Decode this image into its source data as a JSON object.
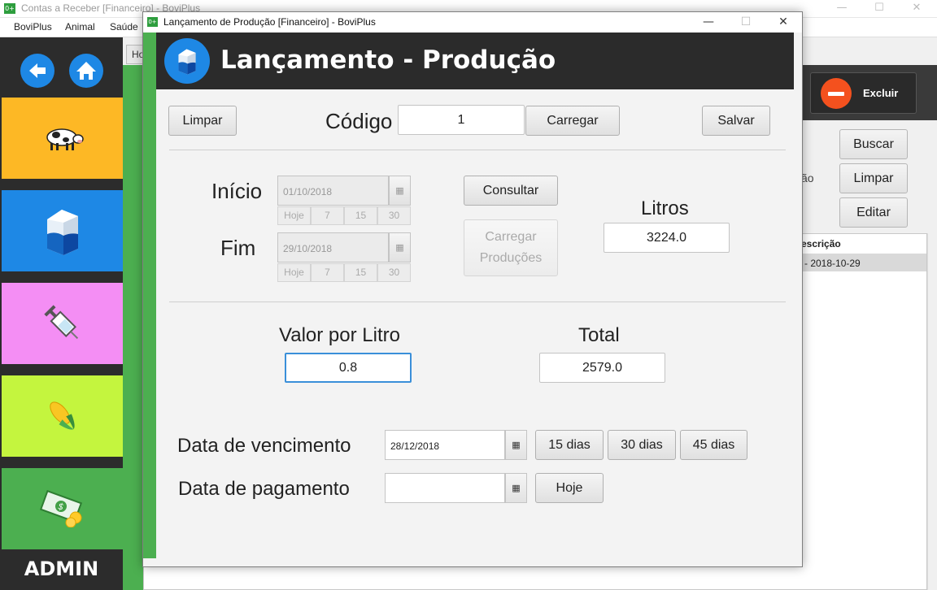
{
  "main_window": {
    "title": "Contas a Receber [Financeiro] - BoviPlus",
    "menu": [
      "BoviPlus",
      "Animal",
      "Saúde"
    ],
    "tab_partial": "Ho",
    "sidebar": {
      "tiles": [
        {
          "name": "animal",
          "icon": "cow-icon",
          "color": "#fdb825"
        },
        {
          "name": "producao",
          "icon": "milk-carton-icon",
          "color": "#1e88e5"
        },
        {
          "name": "saude",
          "icon": "syringe-icon",
          "color": "#f48ef4"
        },
        {
          "name": "alimentacao",
          "icon": "corn-icon",
          "color": "#c4f53e"
        },
        {
          "name": "financeiro",
          "icon": "money-icon",
          "color": "#4caf50"
        }
      ],
      "admin_label": "ADMIN"
    },
    "excluir_label": "Excluir",
    "buttons": {
      "buscar": "Buscar",
      "limpar": "Limpar",
      "editar": "Editar"
    },
    "partial_label": "ão",
    "table": {
      "header_partial": "escrição",
      "rows": [
        "- 2018-10-29"
      ]
    }
  },
  "dialog": {
    "title": "Lançamento de Produção [Financeiro] - BoviPlus",
    "header_title": "Lançamento - Produção",
    "limpar_label": "Limpar",
    "codigo_label": "Código",
    "codigo_value": "1",
    "carregar_label": "Carregar",
    "salvar_label": "Salvar",
    "inicio_label": "Início",
    "inicio_date": "01/10/2018",
    "fim_label": "Fim",
    "fim_date": "29/10/2018",
    "quick_buttons": [
      "Hoje",
      "7",
      "15",
      "30"
    ],
    "consultar_label": "Consultar",
    "carregar_producoes_line1": "Carregar",
    "carregar_producoes_line2": "Produções",
    "litros_label": "Litros",
    "litros_value": "3224.0",
    "valor_litro_label": "Valor por Litro",
    "valor_litro_value": "0.8",
    "total_label": "Total",
    "total_value": "2579.0",
    "vencimento_label": "Data de vencimento",
    "vencimento_date": "28/12/2018",
    "days_buttons": [
      "15 dias",
      "30 dias",
      "45 dias"
    ],
    "pagamento_label": "Data de pagamento",
    "pagamento_date": "",
    "hoje_label": "Hoje"
  }
}
